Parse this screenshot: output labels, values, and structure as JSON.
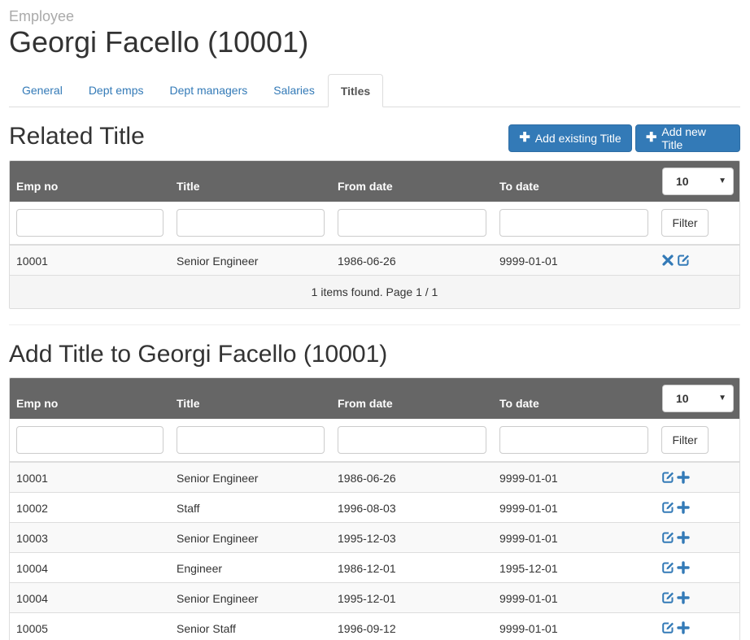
{
  "header": {
    "crumb": "Employee",
    "title": "Georgi Facello (10001)"
  },
  "tabs": [
    {
      "label": "General",
      "active": false
    },
    {
      "label": "Dept emps",
      "active": false
    },
    {
      "label": "Dept managers",
      "active": false
    },
    {
      "label": "Salaries",
      "active": false
    },
    {
      "label": "Titles",
      "active": true
    }
  ],
  "related": {
    "heading": "Related Title",
    "add_existing_label": "Add existing Title",
    "add_new_label": "Add new Title",
    "columns": [
      "Emp no",
      "Title",
      "From date",
      "To date"
    ],
    "page_size": "10",
    "filter_label": "Filter",
    "rows": [
      {
        "emp_no": "10001",
        "title": "Senior Engineer",
        "from_date": "1986-06-26",
        "to_date": "9999-01-01"
      }
    ],
    "footer": "1 items found. Page 1 / 1"
  },
  "add": {
    "heading": "Add Title to Georgi Facello (10001)",
    "columns": [
      "Emp no",
      "Title",
      "From date",
      "To date"
    ],
    "page_size": "10",
    "filter_label": "Filter",
    "rows": [
      {
        "emp_no": "10001",
        "title": "Senior Engineer",
        "from_date": "1986-06-26",
        "to_date": "9999-01-01"
      },
      {
        "emp_no": "10002",
        "title": "Staff",
        "from_date": "1996-08-03",
        "to_date": "9999-01-01"
      },
      {
        "emp_no": "10003",
        "title": "Senior Engineer",
        "from_date": "1995-12-03",
        "to_date": "9999-01-01"
      },
      {
        "emp_no": "10004",
        "title": "Engineer",
        "from_date": "1986-12-01",
        "to_date": "1995-12-01"
      },
      {
        "emp_no": "10004",
        "title": "Senior Engineer",
        "from_date": "1995-12-01",
        "to_date": "9999-01-01"
      },
      {
        "emp_no": "10005",
        "title": "Senior Staff",
        "from_date": "1996-09-12",
        "to_date": "9999-01-01"
      }
    ]
  },
  "icons": {
    "remove": "remove-icon",
    "edit": "edit-icon",
    "add": "plus-icon"
  },
  "colors": {
    "accent": "#337ab7",
    "grid_header": "#666666",
    "icon": "#337ab7"
  }
}
